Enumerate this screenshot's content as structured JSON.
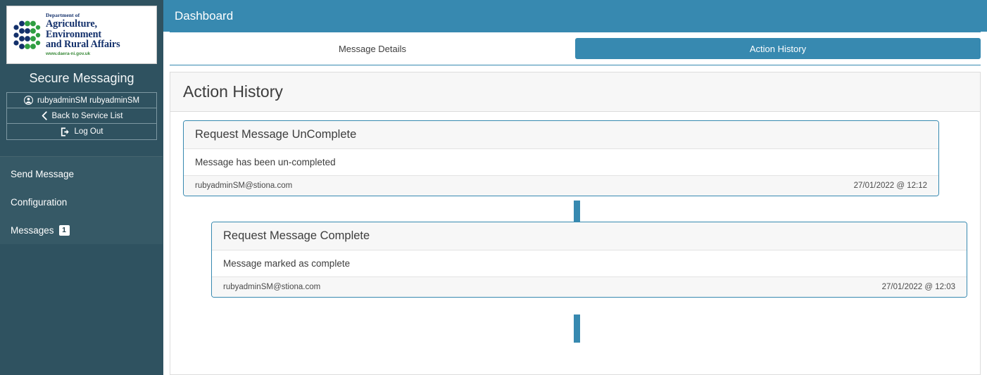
{
  "sidebar": {
    "logo": {
      "icon_name": "daera-hex-dots-logo",
      "department_line": "Department of",
      "name_line1": "Agriculture, Environment",
      "name_line2": "and Rural Affairs",
      "url": "www.daera-ni.gov.uk"
    },
    "app_title": "Secure Messaging",
    "buttons": [
      {
        "label": "rubyadminSM rubyadminSM",
        "icon": "user-circle-icon"
      },
      {
        "label": "Back to Service List",
        "icon": "chevron-left-icon"
      },
      {
        "label": "Log Out",
        "icon": "logout-icon"
      }
    ],
    "nav_items": [
      {
        "label": "Send Message",
        "badge": ""
      },
      {
        "label": "Configuration",
        "badge": ""
      },
      {
        "label": "Messages",
        "badge": "1"
      }
    ]
  },
  "header": {
    "title": "Dashboard"
  },
  "tabs": [
    {
      "label": "Message Details",
      "active": false
    },
    {
      "label": "Action History",
      "active": true
    }
  ],
  "panel": {
    "title": "Action History",
    "entries": [
      {
        "title": "Request Message UnComplete",
        "description": "Message has been un-completed",
        "user": "rubyadminSM@stiona.com",
        "timestamp": "27/01/2022 @ 12:12"
      },
      {
        "title": "Request Message Complete",
        "description": "Message marked as complete",
        "user": "rubyadminSM@stiona.com",
        "timestamp": "27/01/2022 @ 12:03"
      }
    ]
  },
  "colors": {
    "header_teal": "#3789b0",
    "sidebar_dark": "#2f5260",
    "sidebar_nav": "#365966",
    "card_border": "#3789b0",
    "panel_head_bg": "#f7f7f7"
  }
}
